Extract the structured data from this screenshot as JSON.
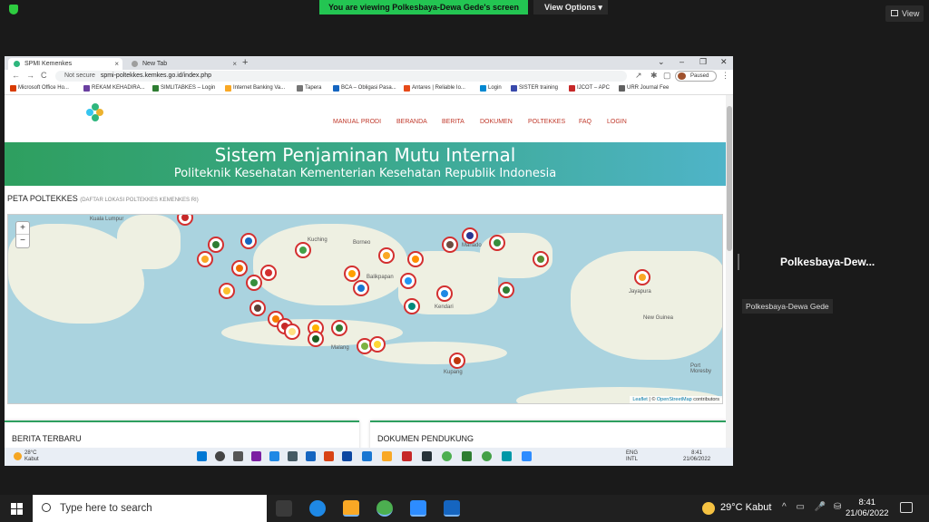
{
  "zoom": {
    "banner": "You are viewing Polkesbaya-Dewa Gede's screen",
    "view_options": "View Options",
    "view_button": "View",
    "participant_name": "Polkesbaya-Dew...",
    "participant_tooltip": "Polkesbaya-Dewa Gede"
  },
  "browser": {
    "tabs": [
      {
        "label": "SPMI Kemenkes",
        "close": "×"
      },
      {
        "label": "New Tab",
        "close": "×"
      }
    ],
    "new_tab": "+",
    "window_controls": {
      "chevron": "⌄",
      "minimize": "–",
      "restore": "❐",
      "close": "✕"
    },
    "nav": {
      "back": "←",
      "forward": "→",
      "reload": "C"
    },
    "security": "Not secure",
    "url": "spmi-poltekkes.kemkes.go.id/index.php",
    "profile_status": "Paused",
    "bookmarks": [
      {
        "label": "Microsoft Office Ho...",
        "color": "#d83b01"
      },
      {
        "label": "REKAM KEHADIRA...",
        "color": "#6a3fa0"
      },
      {
        "label": "SIMLITABKES – Login",
        "color": "#2e7d32"
      },
      {
        "label": "Internet Banking Va...",
        "color": "#f9a825"
      },
      {
        "label": "Tapera",
        "color": "#757575"
      },
      {
        "label": "BCA – Obligasi Pasa...",
        "color": "#1565c0"
      },
      {
        "label": "Antares | Reliable Io...",
        "color": "#e64a19"
      },
      {
        "label": "Login",
        "color": "#0288d1"
      },
      {
        "label": "SISTER training",
        "color": "#3949ab"
      },
      {
        "label": "IJCOT – APC",
        "color": "#c62828"
      },
      {
        "label": "URR Journal Fee",
        "color": "#616161"
      }
    ]
  },
  "site": {
    "nav": [
      "MANUAL PRODI",
      "BERANDA",
      "BERITA",
      "DOKUMEN",
      "POLTEKKES",
      "FAQ",
      "LOGIN"
    ],
    "hero_title": "Sistem Penjaminan Mutu Internal",
    "hero_subtitle": "Politeknik Kesehatan Kementerian Kesehatan Republik Indonesia",
    "map_title": "PETA POLTEKKES",
    "map_subtitle": "(DAFTAR LOKASI POLTEKKES KEMENKES RI)",
    "map_labels": [
      "Kuching",
      "Borneo",
      "Balikpapan",
      "Jayapura",
      "New Guinea",
      "Port Moresby",
      "Kupang",
      "Kendari",
      "Malang",
      "Manado",
      "Kuala Lumpur"
    ],
    "zoom_in": "+",
    "zoom_out": "−",
    "attribution_leaflet": "Leaflet",
    "attribution_sep": " | © ",
    "attribution_osm": "OpenStreetMap",
    "attribution_tail": " contributors",
    "section_news": "BERITA TERBARU",
    "section_docs": "DOKUMEN PENDUKUNG"
  },
  "inner_taskbar": {
    "temp": "28°C",
    "condition": "Kabut",
    "lang_top": "ENG",
    "lang_bottom": "INTL",
    "time": "8:41",
    "date": "21/06/2022"
  },
  "host_taskbar": {
    "search_placeholder": "Type here to search",
    "weather": "29°C  Kabut",
    "time": "8:41",
    "date": "21/06/2022"
  }
}
